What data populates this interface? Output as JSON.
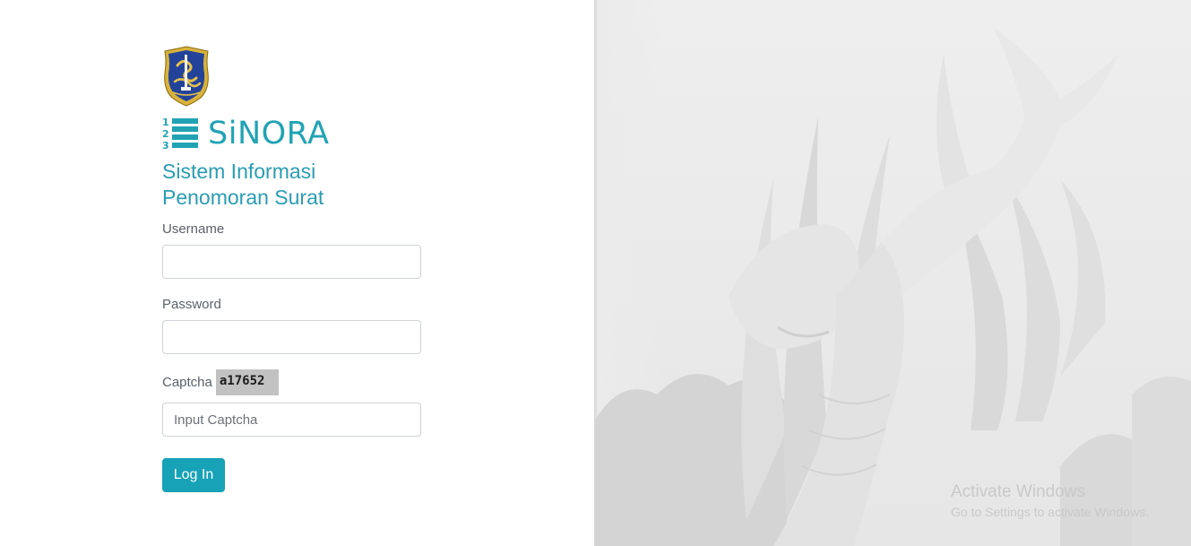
{
  "app": {
    "brand_name": "SiNORA",
    "brand_mark_digits": [
      "1",
      "2",
      "3"
    ],
    "subtitle_line1": "Sistem Informasi",
    "subtitle_line2": "Penomoran Surat",
    "accent_color": "#21a3b4"
  },
  "form": {
    "username_label": "Username",
    "username_value": "",
    "password_label": "Password",
    "password_value": "",
    "captcha_label": "Captcha",
    "captcha_code": "a17652",
    "captcha_placeholder": "Input Captcha",
    "captcha_value": "",
    "login_button_label": "Log In",
    "button_color": "#17a2b8"
  },
  "icons": {
    "logo": "city-emblem-icon",
    "brand_mark": "numbered-list-icon"
  },
  "background": {
    "description_icon": "shark-crocodile-statue-image"
  },
  "os_watermark": {
    "title": "Activate Windows",
    "subtitle": "Go to Settings to activate Windows."
  }
}
